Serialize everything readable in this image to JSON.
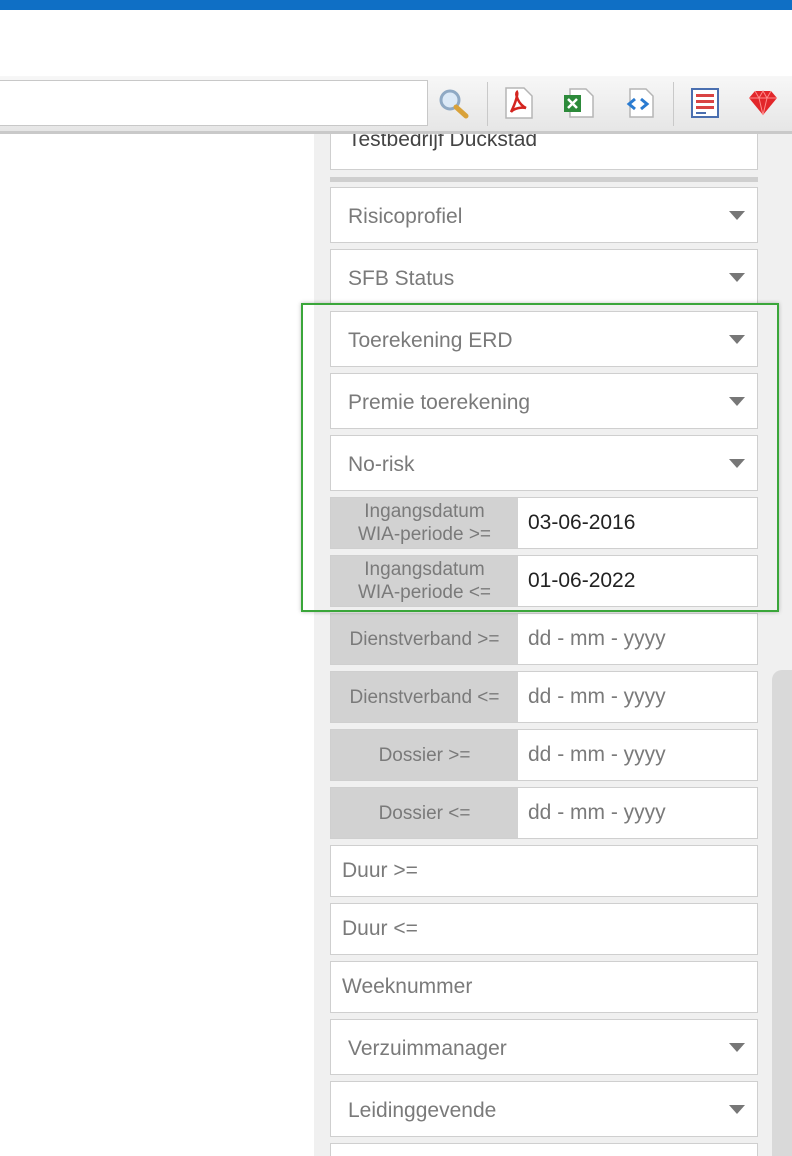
{
  "toolbar": {
    "search_value": "",
    "icons": [
      "search-icon",
      "pdf-export-icon",
      "excel-export-icon",
      "code-export-icon",
      "report-icon",
      "gem-icon"
    ]
  },
  "partial_top_field": "Testbedrijf Duckstad",
  "filters": {
    "risicoprofiel": "Risicoprofiel",
    "sfb_status": "SFB Status",
    "toerekening_erd": "Toerekening ERD",
    "premie_toerekening": "Premie toerekening",
    "no_risk": "No-risk",
    "wia_from": {
      "line1": "Ingangsdatum",
      "line2": "WIA-periode >=",
      "value": "03-06-2016"
    },
    "wia_to": {
      "line1": "Ingangsdatum",
      "line2": "WIA-periode <=",
      "value": "01-06-2022"
    },
    "dienstverband_from": {
      "label": "Dienstverband >=",
      "placeholder": "dd - mm - yyyy"
    },
    "dienstverband_to": {
      "label": "Dienstverband <=",
      "placeholder": "dd - mm - yyyy"
    },
    "dossier_from": {
      "label": "Dossier >=",
      "placeholder": "dd - mm - yyyy"
    },
    "dossier_to": {
      "label": "Dossier <=",
      "placeholder": "dd - mm - yyyy"
    },
    "duur_from": "Duur >=",
    "duur_to": "Duur <=",
    "weeknummer": "Weeknummer",
    "verzuimmanager": "Verzuimmanager",
    "leidinggevende": "Leidinggevende"
  }
}
